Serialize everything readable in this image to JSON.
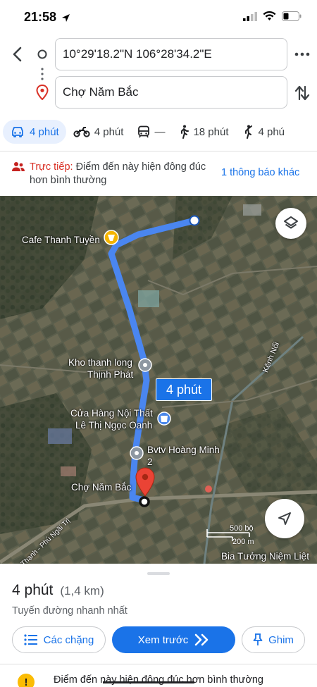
{
  "status_bar": {
    "time": "21:58",
    "battery_level": 0.35
  },
  "route": {
    "origin_value": "10°29'18.2\"N 106°28'34.2\"E",
    "destination_value": "Chợ Năm Bắc",
    "back_icon": "chevron-left-icon",
    "more_icon": "more-horiz-icon",
    "swap_icon": "swap-vert-icon"
  },
  "modes": [
    {
      "icon": "car-icon",
      "label": "4 phút",
      "active": true
    },
    {
      "icon": "motorbike-icon",
      "label": "4 phút",
      "active": false
    },
    {
      "icon": "transit-icon",
      "label": "—",
      "active": false
    },
    {
      "icon": "walk-icon",
      "label": "18 phút",
      "active": false
    },
    {
      "icon": "bike-walk-icon",
      "label": "4 phú",
      "active": false
    }
  ],
  "alert": {
    "live_label": "Trực tiếp:",
    "text": " Điểm đến này hiện đông đúc hơn bình thường",
    "link": "1 thông báo khác"
  },
  "map": {
    "labels": {
      "cafe": "Cafe Thanh Tuyền",
      "warehouse_line1": "Kho thanh long",
      "warehouse_line2": "Thịnh Phát",
      "furniture_line1": "Cửa Hàng Nội Thất",
      "furniture_line2": "Lê Thị Ngọc Oanh",
      "clinic_line1": "Bvtv Hoàng Minh",
      "clinic_line2": "2",
      "market": "Chợ Năm Bắc",
      "canal": "Kênh Nổi",
      "road": "Thạnh - Phú Ngãi Trị",
      "memorial": "Bia Tưởng Niệm Liệt"
    },
    "duration_label": "4 phút",
    "scale_feet": "500 bộ",
    "scale_meters": "200 m",
    "route_color": "#4a86f0"
  },
  "sheet": {
    "duration": "4 phút",
    "distance": "(1,4 km)",
    "subtitle": "Tuyến đường nhanh nhất",
    "steps_label": "Các chặng",
    "preview_label": "Xem trước",
    "pin_label": "Ghim",
    "warning_icon": "!",
    "warning_text": "Điểm đến này hiện đông đúc hơn bình thường"
  },
  "colors": {
    "accent": "#1a73e8",
    "live_red": "#d93025",
    "warning": "#fbbc04"
  }
}
